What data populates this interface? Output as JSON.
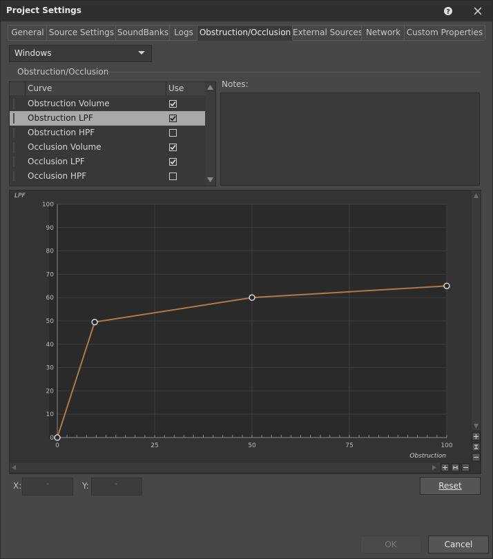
{
  "window": {
    "title": "Project Settings"
  },
  "tabs": [
    {
      "label": "General"
    },
    {
      "label": "Source Settings"
    },
    {
      "label": "SoundBanks"
    },
    {
      "label": "Logs"
    },
    {
      "label": "Obstruction/Occlusion",
      "active": true
    },
    {
      "label": "External Sources"
    },
    {
      "label": "Network"
    },
    {
      "label": "Custom Properties"
    }
  ],
  "platform": {
    "selected": "Windows"
  },
  "section": {
    "title": "Obstruction/Occlusion"
  },
  "curve_list": {
    "headers": {
      "curve": "Curve",
      "use": "Use"
    },
    "rows": [
      {
        "name": "Obstruction Volume",
        "use": true,
        "selected": false
      },
      {
        "name": "Obstruction LPF",
        "use": true,
        "selected": true
      },
      {
        "name": "Obstruction HPF",
        "use": false,
        "selected": false
      },
      {
        "name": "Occlusion Volume",
        "use": true,
        "selected": false
      },
      {
        "name": "Occlusion LPF",
        "use": true,
        "selected": false
      },
      {
        "name": "Occlusion HPF",
        "use": false,
        "selected": false
      }
    ]
  },
  "notes": {
    "label": "Notes:",
    "value": ""
  },
  "chart_data": {
    "type": "line",
    "ylabel": "LPF",
    "xlabel": "Obstruction",
    "xlim": [
      0,
      100
    ],
    "ylim": [
      0,
      100
    ],
    "x_ticks": [
      "0",
      "25",
      "50",
      "75",
      "100"
    ],
    "y_ticks": [
      "0",
      "10",
      "20",
      "30",
      "40",
      "50",
      "60",
      "70",
      "80",
      "90",
      "100"
    ],
    "grid": true,
    "series": [
      {
        "color": "#b07a4e",
        "points": [
          [
            0,
            0
          ],
          [
            9.6,
            49.5
          ],
          [
            50,
            60
          ],
          [
            100,
            65
          ]
        ]
      }
    ]
  },
  "coords": {
    "x_label": "X:",
    "y_label": "Y:",
    "x_value": "-",
    "y_value": "-"
  },
  "buttons": {
    "reset": "Reset",
    "ok": "OK",
    "cancel": "Cancel"
  }
}
